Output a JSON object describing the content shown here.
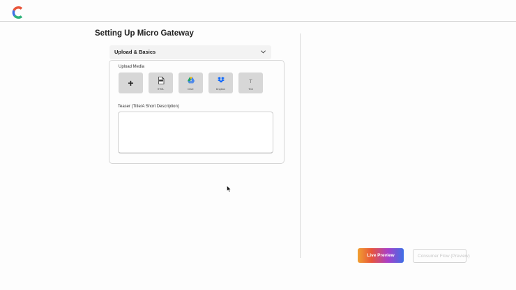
{
  "page": {
    "title": "Setting Up Micro Gateway"
  },
  "accordion": {
    "label": "Upload & Basics"
  },
  "upload": {
    "label": "Upload Media",
    "tiles": [
      {
        "icon": "plus-icon",
        "glyph": "+",
        "caption": ""
      },
      {
        "icon": "file-icon",
        "caption": "HTML"
      },
      {
        "icon": "google-drive-icon",
        "caption": "Drive"
      },
      {
        "icon": "dropbox-icon",
        "caption": "Dropbox"
      },
      {
        "icon": "text-icon",
        "glyph": "T",
        "caption": "Text"
      }
    ]
  },
  "teaser": {
    "label": "Teaser (Title/A Short Description)",
    "value": ""
  },
  "buttons": {
    "live_preview": "Live Preview",
    "consumer_flow": "Consumer Flow (Preview)"
  },
  "colors": {
    "accent_start": "#f0a030",
    "accent_mid": "#a93fc8",
    "accent_end": "#3e6fe6"
  }
}
